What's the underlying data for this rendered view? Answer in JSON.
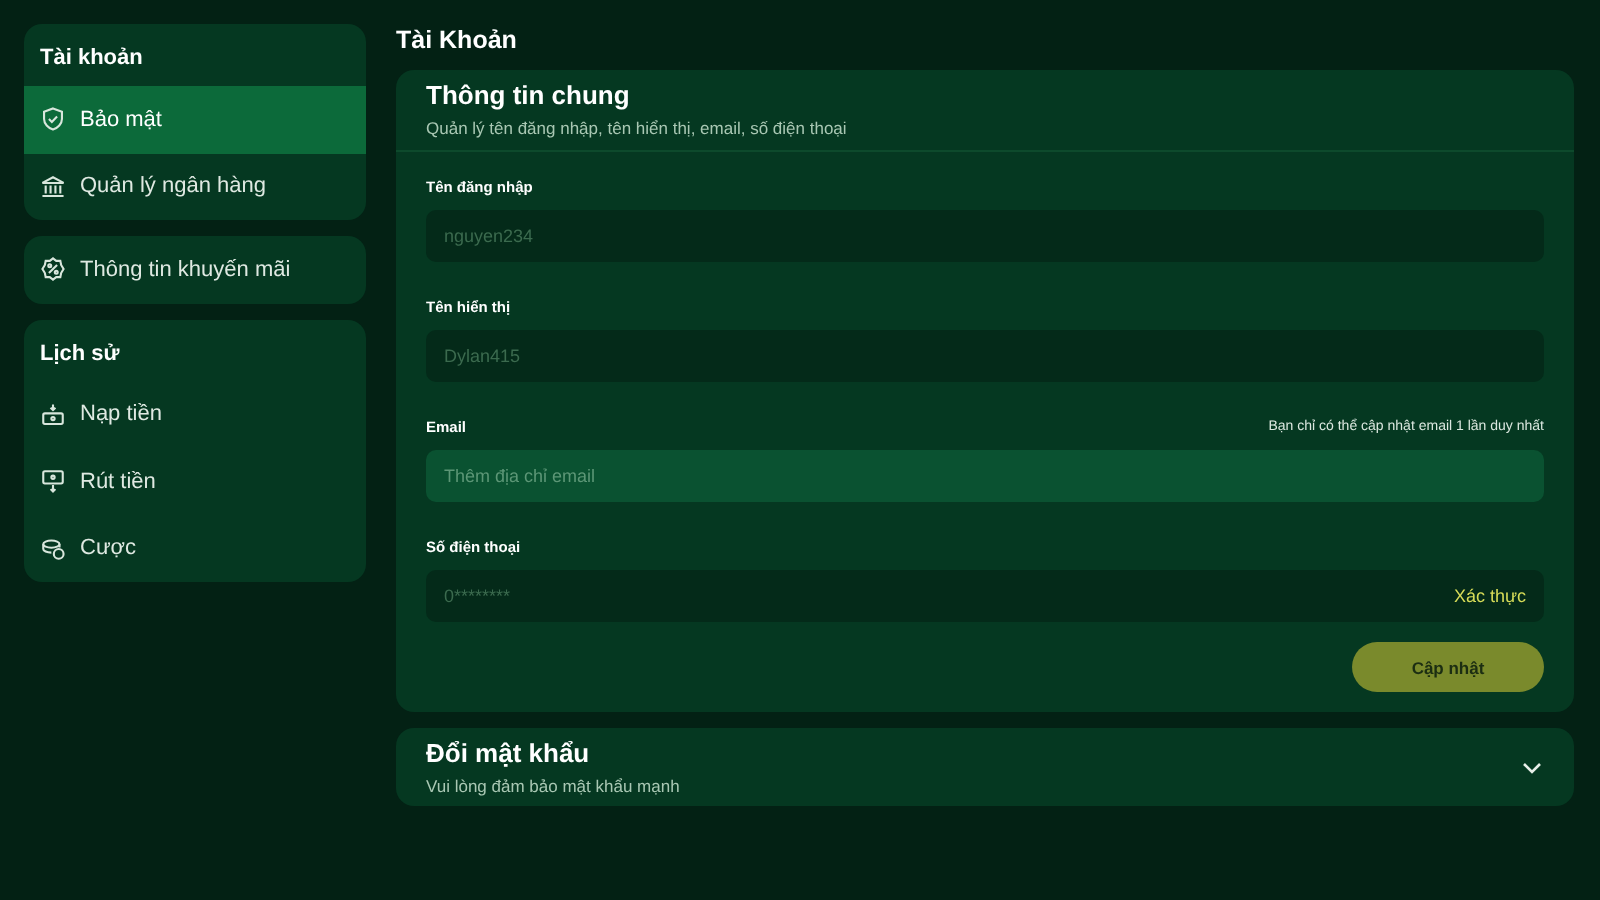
{
  "sidebar": {
    "groups": [
      {
        "title": "Tài khoản",
        "items": [
          {
            "label": "Bảo mật",
            "selected": true
          },
          {
            "label": "Quản lý ngân hàng",
            "selected": false
          }
        ]
      },
      {
        "items": [
          {
            "label": "Thông tin khuyến mãi",
            "selected": false
          }
        ]
      },
      {
        "title": "Lịch sử",
        "items": [
          {
            "label": "Nạp tiền",
            "selected": false
          },
          {
            "label": "Rút tiền",
            "selected": false
          },
          {
            "label": "Cược",
            "selected": false
          }
        ]
      }
    ]
  },
  "page_title": "Tài Khoản",
  "general_card": {
    "title": "Thông tin chung",
    "subtitle": "Quản lý tên đăng nhập, tên hiển thị, email, số điện thoại",
    "fields": [
      {
        "label": "Tên đăng nhập",
        "value": "nguyen234",
        "disabled": true
      },
      {
        "label": "Tên hiển thị",
        "value": "Dylan415",
        "disabled": true
      },
      {
        "label": "Email",
        "note": "Bạn chỉ có thể cập nhật email 1 lần duy nhất",
        "placeholder": "Thêm địa chỉ email",
        "disabled": false
      },
      {
        "label": "Số điện thoại",
        "value": "0********",
        "action": "Xác thực",
        "disabled": true
      }
    ],
    "button": "Cập nhật"
  },
  "password_card": {
    "title": "Đổi mật khẩu",
    "subtitle": "Vui lòng đảm bảo mật khẩu mạnh",
    "expanded": false
  }
}
